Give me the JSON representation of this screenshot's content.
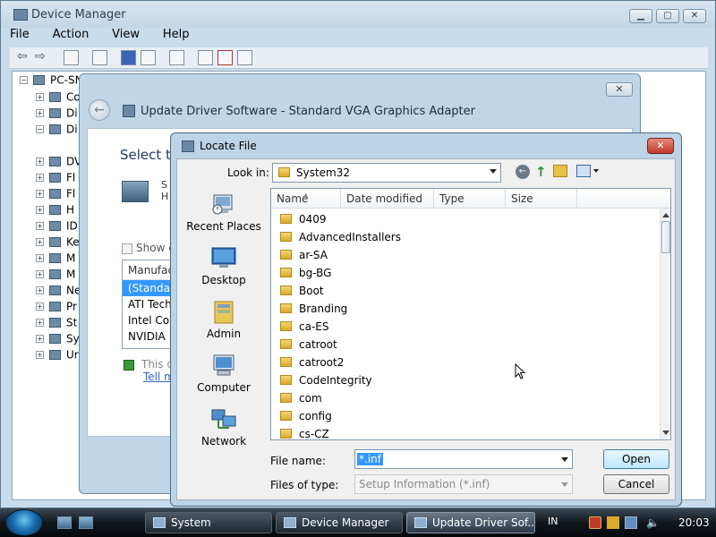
{
  "device_manager": {
    "title": "Device Manager",
    "menu": [
      "File",
      "Action",
      "View",
      "Help"
    ],
    "tree_root": "PC-SN",
    "tree_items": [
      "Co",
      "Di",
      "Di",
      "DV",
      "Fl",
      "Fl",
      "H",
      "ID",
      "Ke",
      "M",
      "M",
      "Ne",
      "Pr",
      "St",
      "Sy",
      "Ur"
    ]
  },
  "update_driver": {
    "title": "Update Driver Software - Standard VGA Graphics Adapter",
    "heading": "Select th",
    "device_text_1": "S",
    "device_text_2": "H",
    "show_compatible": "Show c",
    "manufacturer_header": "Manufac",
    "manufacturers": [
      "(Standar",
      "ATI Tech",
      "Intel Cor",
      "NVIDIA"
    ],
    "signed_text": "This d",
    "tell_me": "Tell m"
  },
  "locate_file": {
    "title": "Locate File",
    "look_in_label": "Look in:",
    "look_in_value": "System32",
    "places": [
      "Recent Places",
      "Desktop",
      "Admin",
      "Computer",
      "Network"
    ],
    "columns": [
      "Name",
      "Date modified",
      "Type",
      "Size"
    ],
    "files": [
      "0409",
      "AdvancedInstallers",
      "ar-SA",
      "bg-BG",
      "Boot",
      "Branding",
      "ca-ES",
      "catroot",
      "catroot2",
      "CodeIntegrity",
      "com",
      "config",
      "cs-CZ"
    ],
    "file_name_label": "File name:",
    "file_name_value": "*.inf",
    "files_of_type_label": "Files of type:",
    "files_of_type_value": "Setup Information (*.inf)",
    "open_label": "Open",
    "cancel_label": "Cancel"
  },
  "taskbar": {
    "tasks": [
      "System",
      "Device Manager",
      "Update Driver Sof..."
    ],
    "language": "IN",
    "clock": "20:03"
  },
  "colors": {
    "selection": "#3399ff",
    "link": "#2a62c9",
    "close_red": "#c0392b",
    "default_button": "#bee6fd"
  }
}
